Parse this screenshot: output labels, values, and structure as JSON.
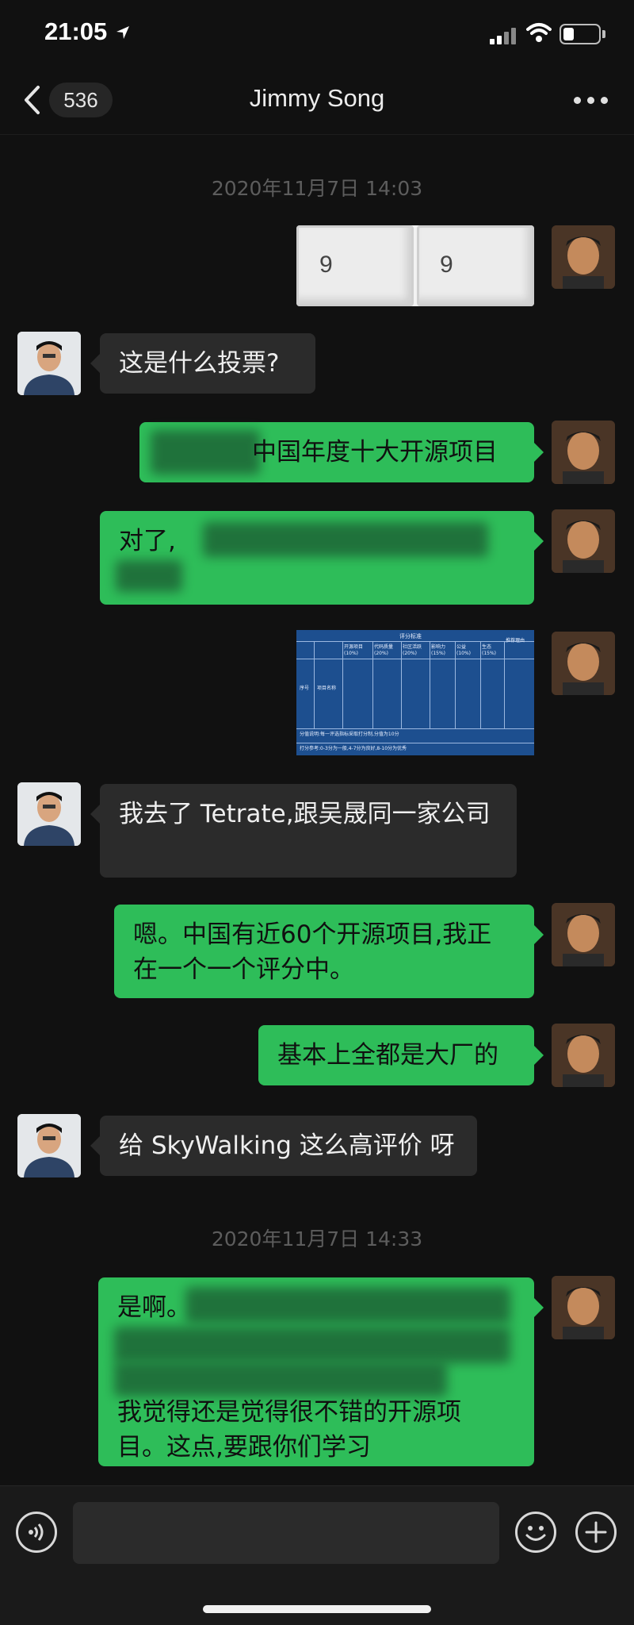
{
  "status_bar": {
    "time": "21:05"
  },
  "nav": {
    "unread_count": "536",
    "title": "Jimmy Song"
  },
  "timestamps": [
    "2020年11月7日 14:03",
    "2020年11月7日 14:33"
  ],
  "dice": {
    "die1": "9",
    "die2": "9"
  },
  "messages": {
    "m2": "这是什么投票?",
    "m3_visible": "中国年度十大开源项目",
    "m4_visible": "对了,",
    "m6": "我去了 Tetrate,跟吴晟同一家公司",
    "m7": "嗯。中国有近60个开源项目,我正在一个一个评分中。",
    "m8": "基本上全都是大厂的",
    "m9": "给 SkyWalking 这么高评价 呀",
    "m10_line1": "是啊。",
    "m10_line2": "我觉得还是觉得很不错的开源项目。这点,要跟你们学习"
  },
  "table_image": {
    "header": "评分标准",
    "cols": [
      "开源项目(10%)",
      "代码质量(20%)",
      "社区活跃(20%)",
      "影响力(15%)",
      "公益(10%)",
      "生态(15%)",
      "推荐理由"
    ],
    "row_label_1": "序号",
    "row_label_2": "项目名称",
    "note1": "分值说明:每一评选指标采取打分制,分值为10分",
    "note2": "打分参考:0-3分为一般,4-7分为良好,8-10分为优秀"
  },
  "input": {
    "placeholder": ""
  },
  "colors": {
    "bubble_sent": "#2ebd59",
    "bubble_received": "#2b2b2b",
    "background": "#111111"
  }
}
